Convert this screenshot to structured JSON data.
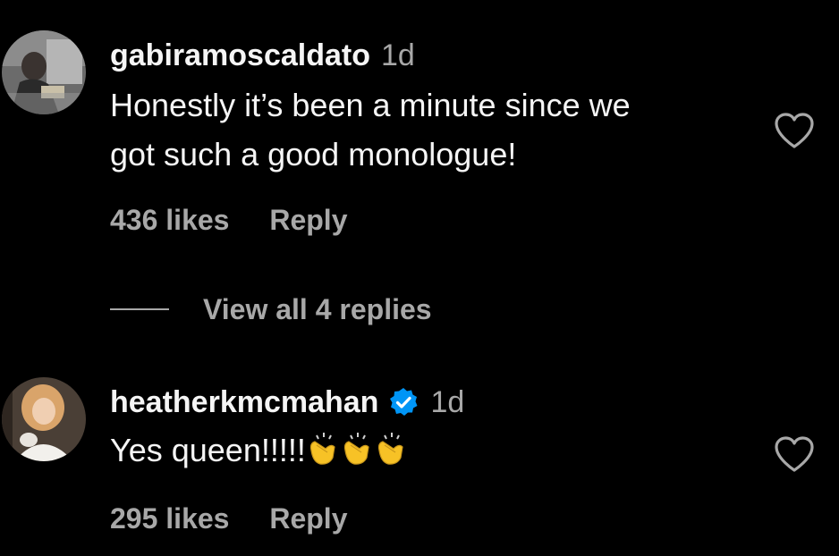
{
  "comments": [
    {
      "username": "gabiramoscaldato",
      "time": "1d",
      "text_lines": [
        "Honestly it’s been a minute since we",
        "got such a good monologue!"
      ],
      "likes": "436 likes",
      "reply_label": "Reply",
      "verified": false,
      "icon": "heart-outline-icon"
    },
    {
      "username": "heatherkmcmahan",
      "time": "1d",
      "text": "Yes queen!!!!!",
      "emojis": [
        "clapping-hands-emoji",
        "clapping-hands-emoji",
        "clapping-hands-emoji"
      ],
      "likes": "295 likes",
      "reply_label": "Reply",
      "verified": true,
      "icon": "heart-outline-icon"
    }
  ],
  "view_replies_label": "View all 4 replies",
  "colors": {
    "background": "#000000",
    "primary_text": "#f5f5f5",
    "secondary_text": "#a8a8a8",
    "verified_blue": "#0095f6",
    "emoji_yellow": "#f7c226"
  }
}
